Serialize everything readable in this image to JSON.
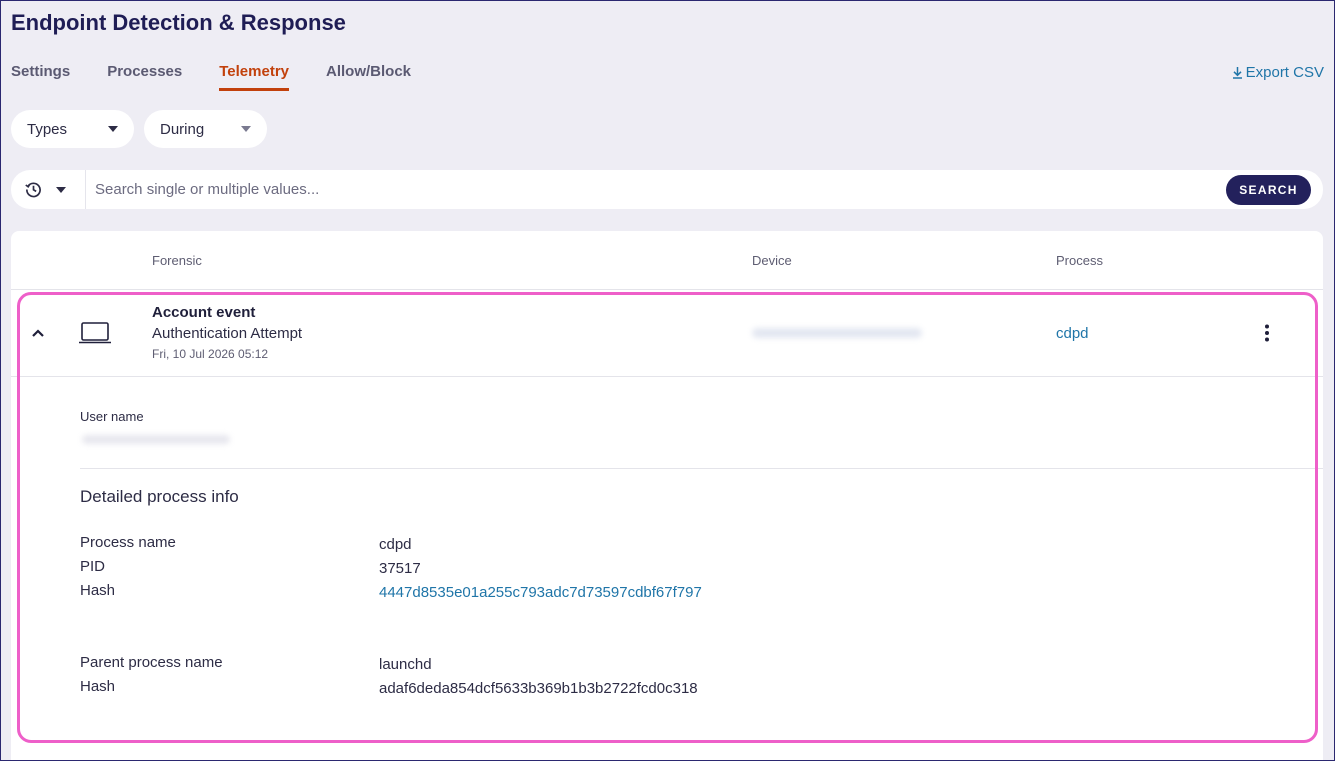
{
  "page": {
    "title": "Endpoint Detection & Response"
  },
  "tabs": [
    {
      "label": "Settings"
    },
    {
      "label": "Processes"
    },
    {
      "label": "Telemetry"
    },
    {
      "label": "Allow/Block"
    }
  ],
  "active_tab": "Telemetry",
  "export": {
    "label": "Export CSV",
    "icon": "download-icon"
  },
  "filters": {
    "types_label": "Types",
    "during_label": "During"
  },
  "search": {
    "placeholder": "Search single or multiple values...",
    "button_label": "SEARCH",
    "history_icon": "history-icon"
  },
  "table": {
    "columns": {
      "forensic": "Forensic",
      "device": "Device",
      "process": "Process"
    },
    "row": {
      "event_type": "Account event",
      "event_subtype": "Authentication Attempt",
      "timestamp": "Fri, 10 Jul 2026 05:12",
      "device": "[redacted]",
      "process": "cdpd",
      "icon": "laptop-icon"
    }
  },
  "detail": {
    "user_name_label": "User name",
    "user_name_value": "[redacted]",
    "section_title": "Detailed process info",
    "process_name_label": "Process name",
    "process_name_value": "cdpd",
    "pid_label": "PID",
    "pid_value": "37517",
    "hash_label": "Hash",
    "hash_value": "4447d8535e01a255c793adc7d73597cdbf67f797",
    "parent_process_name_label": "Parent process name",
    "parent_process_name_value": "launchd",
    "parent_hash_label": "Hash",
    "parent_hash_value": "adaf6deda854dcf5633b369b1b3b2722fcd0c318"
  },
  "colors": {
    "accent": "#c2410c",
    "link": "#1f75a8",
    "primary": "#23215c",
    "highlight": "#ee5fc9",
    "background": "#eeedf4"
  }
}
